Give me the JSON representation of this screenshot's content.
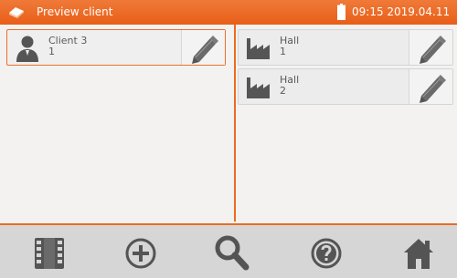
{
  "titlebar": {
    "title": "Preview client",
    "datetime": "09:15 2019.04.11",
    "logo_icon": "eraser-logo-icon",
    "battery_icon": "battery-icon",
    "accent_color": "#ec6a22"
  },
  "left_panel": {
    "items": [
      {
        "label": "Client 3",
        "number": "1",
        "icon": "person-icon",
        "selected": true
      }
    ]
  },
  "right_panel": {
    "items": [
      {
        "label": "Hall",
        "number": "1",
        "icon": "factory-icon"
      },
      {
        "label": "Hall",
        "number": "2",
        "icon": "factory-icon"
      }
    ]
  },
  "toolbar": {
    "buttons": [
      {
        "name": "film-strip-button",
        "icon": "film-strip-icon"
      },
      {
        "name": "add-button",
        "icon": "plus-circle-icon"
      },
      {
        "name": "search-button",
        "icon": "magnifier-icon"
      },
      {
        "name": "help-button",
        "icon": "question-circle-icon"
      },
      {
        "name": "home-button",
        "icon": "home-icon"
      }
    ]
  }
}
